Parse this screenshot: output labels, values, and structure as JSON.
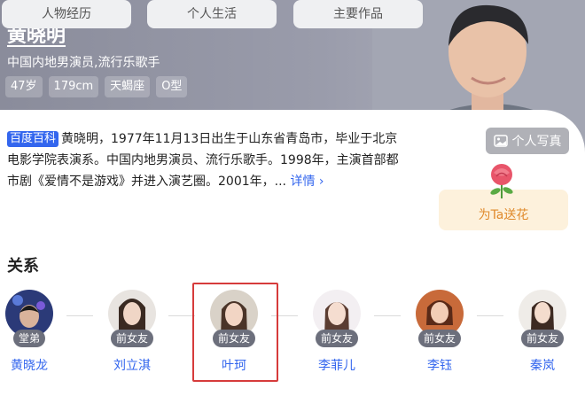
{
  "profile": {
    "name": "黄晓明",
    "occupation": "中国内地男演员,流行乐歌手",
    "tags": [
      "47岁",
      "179cm",
      "天蝎座",
      "O型"
    ],
    "photo_button": "个人写真"
  },
  "summary": {
    "source_badge": "百度百科",
    "text": "黄晓明，1977年11月13日出生于山东省青岛市，毕业于北京电影学院表演系。中国内地男演员、流行乐歌手。1998年，主演首部都市剧《爱情不是游戏》并进入演艺圈。2001年，",
    "ellipsis": "...",
    "more": "详情 ›"
  },
  "tabs": [
    "人物经历",
    "个人生活",
    "主要作品"
  ],
  "gift": {
    "label": "为Ta送花",
    "icon": "rose-icon"
  },
  "relations": {
    "title": "关系",
    "people": [
      {
        "name": "黄晓龙",
        "relation": "堂弟"
      },
      {
        "name": "刘立淇",
        "relation": "前女友"
      },
      {
        "name": "叶珂",
        "relation": "前女友"
      },
      {
        "name": "李菲儿",
        "relation": "前女友"
      },
      {
        "name": "李钰",
        "relation": "前女友"
      },
      {
        "name": "秦岚",
        "relation": "前女友"
      }
    ]
  },
  "colors": {
    "accent": "#3366ee",
    "highlight_border": "#d63b3b",
    "gift_bg": "#fdf1dc",
    "gift_text": "#e08a2c"
  }
}
